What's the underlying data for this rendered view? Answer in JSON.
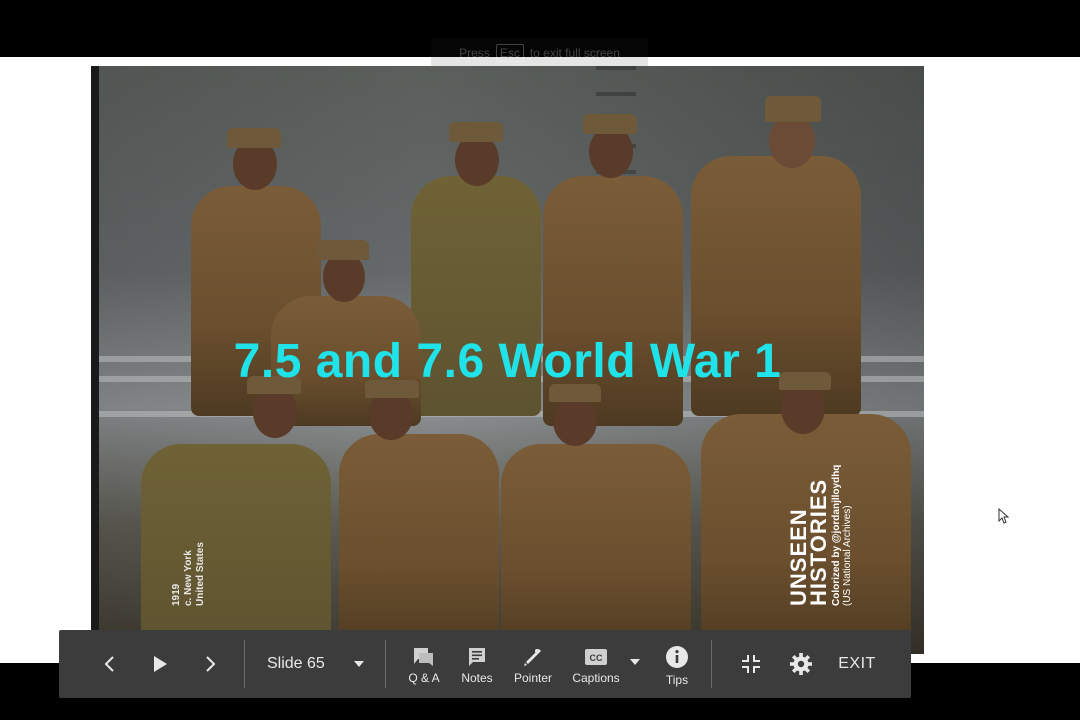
{
  "toast": {
    "press": "Press",
    "key": "Esc",
    "suffix": "to exit full screen"
  },
  "slide": {
    "title": "7.5 and 7.6 World War 1",
    "photo_caption": {
      "year": "1919",
      "city": "c. New York",
      "country": "United States"
    },
    "credit": {
      "brand_line1": "UNSEEN",
      "brand_line2": "HISTORIES",
      "colorized": "Colorized by @jordanjlloydhq",
      "source": "(US National Archives)"
    },
    "title_color": "#1fe3e8"
  },
  "controls": {
    "prev_icon": "chevron-left-icon",
    "play_icon": "play-icon",
    "next_icon": "chevron-right-icon",
    "slide_label": "Slide 65",
    "qa_label": "Q & A",
    "notes_label": "Notes",
    "pointer_label": "Pointer",
    "captions_label": "Captions",
    "tips_label": "Tips",
    "exit_label": "EXIT"
  },
  "colors": {
    "bar_bg": "#3c3c3c",
    "bar_text": "#e8e8e8"
  }
}
